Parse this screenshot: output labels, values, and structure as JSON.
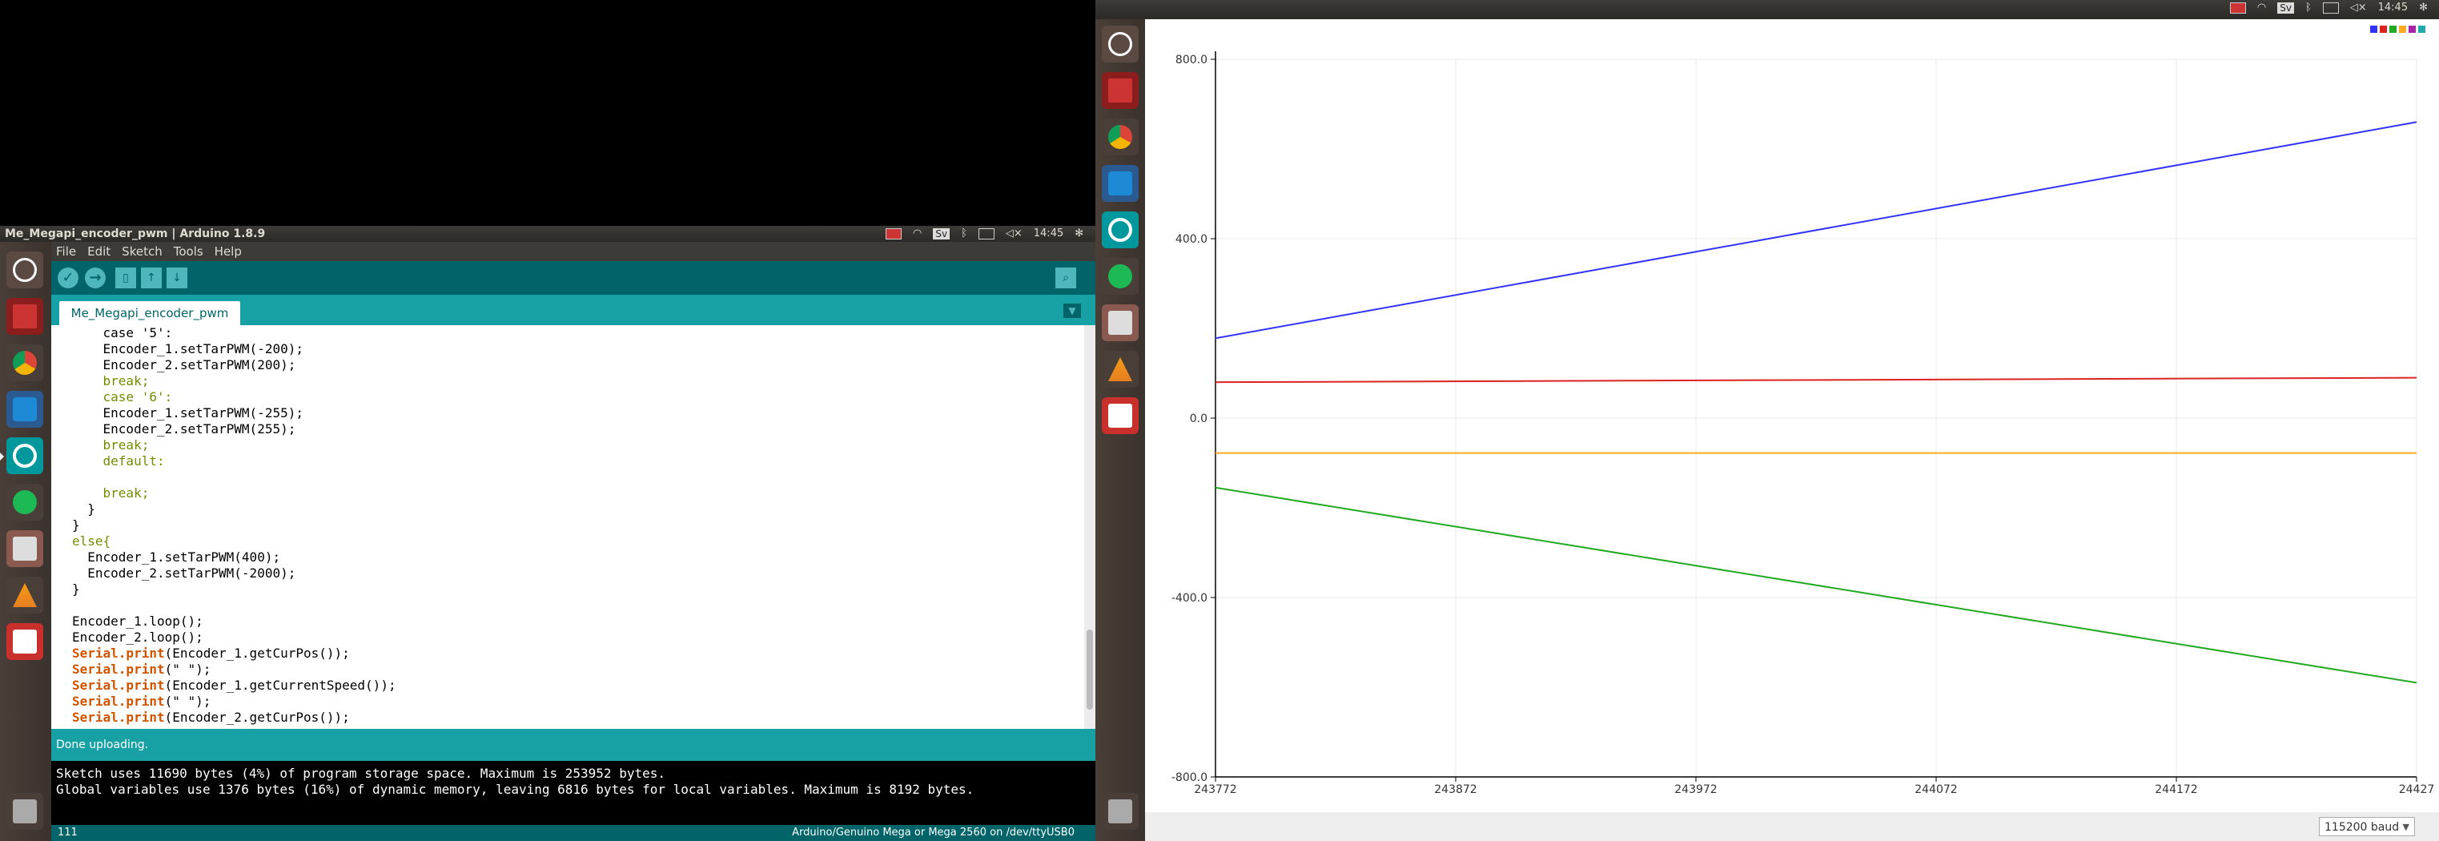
{
  "left_window_title": "Me_Megapi_encoder_pwm | Arduino 1.8.9",
  "panel_time": "14:45",
  "tray_sv": "Sv",
  "menu": [
    "File",
    "Edit",
    "Sketch",
    "Tools",
    "Help"
  ],
  "tab_name": "Me_Megapi_encoder_pwm",
  "code": {
    "l1": "    case '5':",
    "l2": "    Encoder_1.setTarPWM(-200);",
    "l3": "    Encoder_2.setTarPWM(200);",
    "l4": "    break;",
    "l5": "    case '6':",
    "l6": "    Encoder_1.setTarPWM(-255);",
    "l7": "    Encoder_2.setTarPWM(255);",
    "l8": "    break;",
    "l9": "    default:",
    "l10": "",
    "l11": "    break;",
    "l12": "  }",
    "l13": "}",
    "l14": "else{",
    "l15": "  Encoder_1.setTarPWM(400);",
    "l16": "  Encoder_2.setTarPWM(-2000);",
    "l17": "}",
    "l18": "",
    "l19": "Encoder_1.loop();",
    "l20": "Encoder_2.loop();",
    "l21a": "Serial.print",
    "l21b": "(Encoder_1.getCurPos());",
    "l22a": "Serial.print",
    "l22b": "(\" \");",
    "l23a": "Serial.print",
    "l23b": "(Encoder_1.getCurrentSpeed());",
    "l24a": "Serial.print",
    "l24b": "(\" \");",
    "l25a": "Serial.print",
    "l25b": "(Encoder_2.getCurPos());"
  },
  "status": "Done uploading.",
  "console": [
    "Sketch uses 11690 bytes (4%) of program storage space. Maximum is 253952 bytes.",
    "Global variables use 1376 bytes (16%) of dynamic memory, leaving 6816 bytes for local variables. Maximum is 8192 bytes."
  ],
  "line_number": "111",
  "board_info": "Arduino/Genuino Mega or Mega 2560 on /dev/ttyUSB0",
  "baud": "115200 baud",
  "colors": {
    "teal_dark": "#006468",
    "teal_light": "#17a1a5",
    "series_blue": "#3333ff",
    "series_red": "#dd2222",
    "series_orange": "#ffaa22",
    "series_green": "#22aa22"
  },
  "launcher_icons": [
    "ubuntu-dash-icon",
    "remote-desktop-icon",
    "chrome-icon",
    "vscode-icon",
    "arduino-icon",
    "spotify-icon",
    "files-icon",
    "vlc-icon",
    "pdf-viewer-icon",
    "trash-icon"
  ],
  "chart_data": {
    "type": "line",
    "title": "",
    "xlabel": "",
    "ylabel": "",
    "x_ticks": [
      "243772",
      "243872",
      "243972",
      "244072",
      "244172",
      "24427"
    ],
    "y_ticks": [
      "800.0",
      "400.0",
      "0.0",
      "-400.0",
      "-800.0"
    ],
    "ylim": [
      -800,
      800
    ],
    "xlim": [
      243772,
      244272
    ],
    "series": [
      {
        "color": "#3333ff",
        "x": [
          243772,
          244272
        ],
        "y": [
          178,
          660
        ]
      },
      {
        "color": "#dd2222",
        "x": [
          243772,
          244272
        ],
        "y": [
          80,
          90
        ]
      },
      {
        "color": "#ffaa22",
        "x": [
          243772,
          244272
        ],
        "y": [
          -78,
          -78
        ]
      },
      {
        "color": "#22aa22",
        "x": [
          243772,
          244272
        ],
        "y": [
          -155,
          -590
        ]
      }
    ],
    "grid": true,
    "legend": "top-right"
  }
}
